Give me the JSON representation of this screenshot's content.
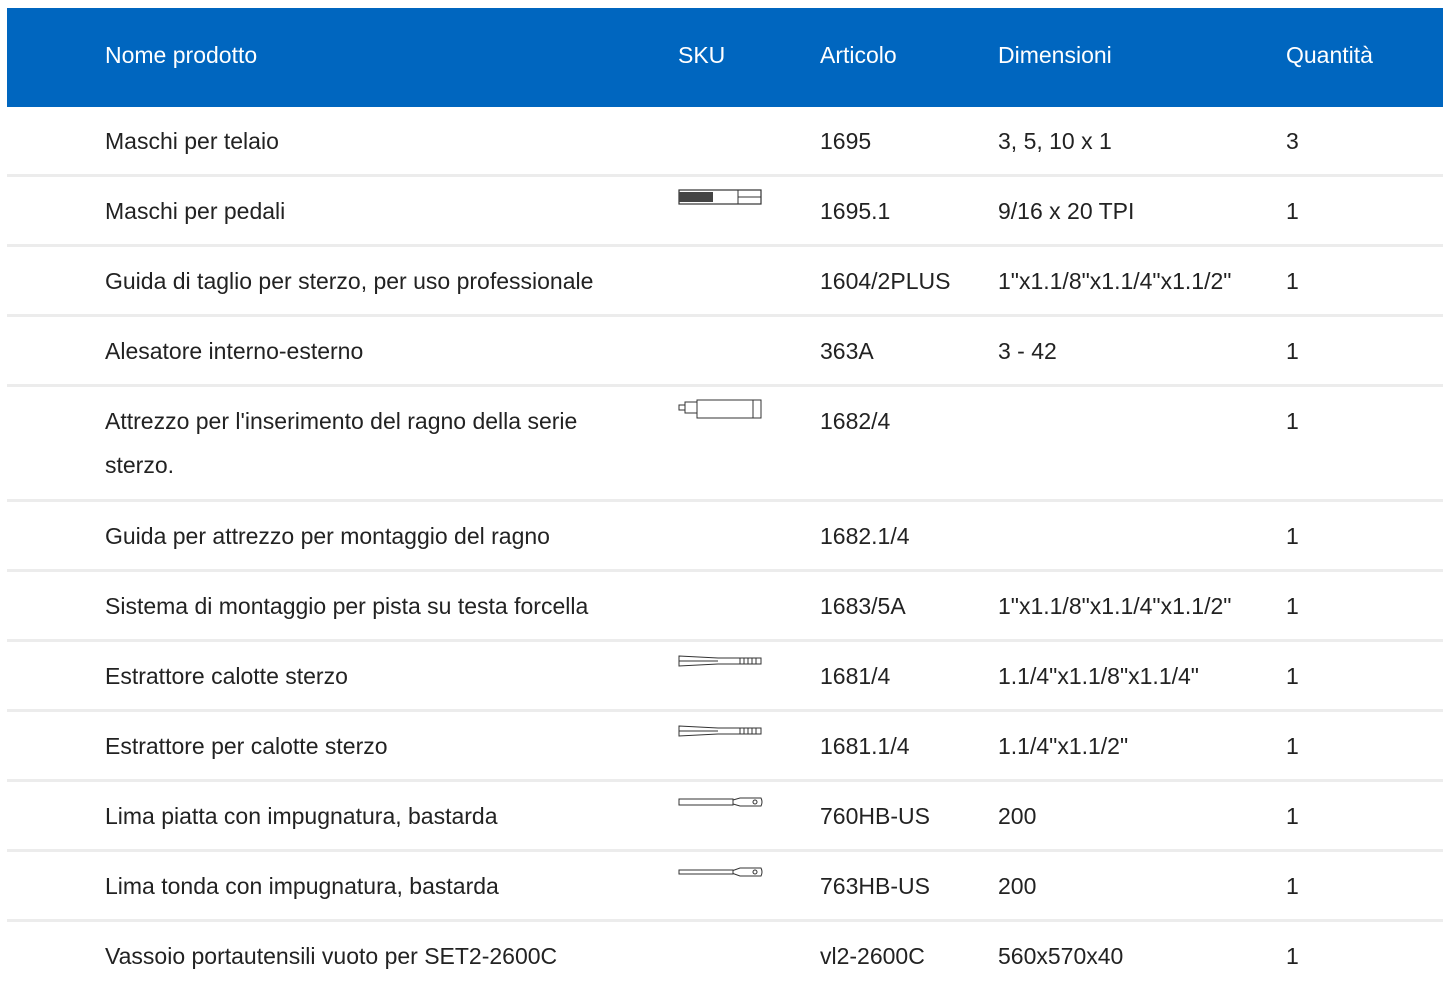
{
  "header": {
    "name": "Nome prodotto",
    "sku": "SKU",
    "article": "Articolo",
    "dimensions": "Dimensioni",
    "quantity": "Quantità"
  },
  "rows": [
    {
      "name": "Maschi per telaio",
      "sku_icon": "",
      "article": "1695",
      "dimensions": "3, 5, 10 x 1",
      "quantity": "3"
    },
    {
      "name": "Maschi per pedali",
      "sku_icon": "tap-icon",
      "article": "1695.1",
      "dimensions": "9/16 x 20 TPI",
      "quantity": "1"
    },
    {
      "name": "Guida di taglio per sterzo, per uso professionale",
      "sku_icon": "",
      "article": "1604/2PLUS",
      "dimensions": "1\"x1.1/8\"x1.1/4\"x1.1/2\"",
      "quantity": "1"
    },
    {
      "name": "Alesatore interno-esterno",
      "sku_icon": "",
      "article": "363A",
      "dimensions": "3 - 42",
      "quantity": "1"
    },
    {
      "name": "Attrezzo per l'inserimento del ragno della serie sterzo.",
      "sku_icon": "insert-tool-icon",
      "article": "1682/4",
      "dimensions": "",
      "quantity": "1"
    },
    {
      "name": "Guida per attrezzo per montaggio del ragno",
      "sku_icon": "",
      "article": "1682.1/4",
      "dimensions": "",
      "quantity": "1"
    },
    {
      "name": "Sistema di montaggio per pista su testa forcella",
      "sku_icon": "",
      "article": "1683/5A",
      "dimensions": "1\"x1.1/8\"x1.1/4\"x1.1/2\"",
      "quantity": "1"
    },
    {
      "name": "Estrattore calotte sterzo",
      "sku_icon": "extractor-icon",
      "article": "1681/4",
      "dimensions": "1.1/4\"x1.1/8\"x1.1/4\"",
      "quantity": "1"
    },
    {
      "name": "Estrattore per calotte sterzo",
      "sku_icon": "extractor-icon",
      "article": "1681.1/4",
      "dimensions": "1.1/4\"x1.1/2\"",
      "quantity": "1"
    },
    {
      "name": "Lima piatta con impugnatura, bastarda",
      "sku_icon": "flat-file-icon",
      "article": "760HB-US",
      "dimensions": "200",
      "quantity": "1"
    },
    {
      "name": "Lima tonda con impugnatura, bastarda",
      "sku_icon": "round-file-icon",
      "article": "763HB-US",
      "dimensions": "200",
      "quantity": "1"
    },
    {
      "name": "Vassoio portautensili vuoto per SET2-2600C",
      "sku_icon": "",
      "article": "vl2-2600C",
      "dimensions": "560x570x40",
      "quantity": "1"
    }
  ],
  "colors": {
    "header_bg": "#0066bf",
    "header_text": "#ffffff",
    "row_divider": "#ececec"
  }
}
